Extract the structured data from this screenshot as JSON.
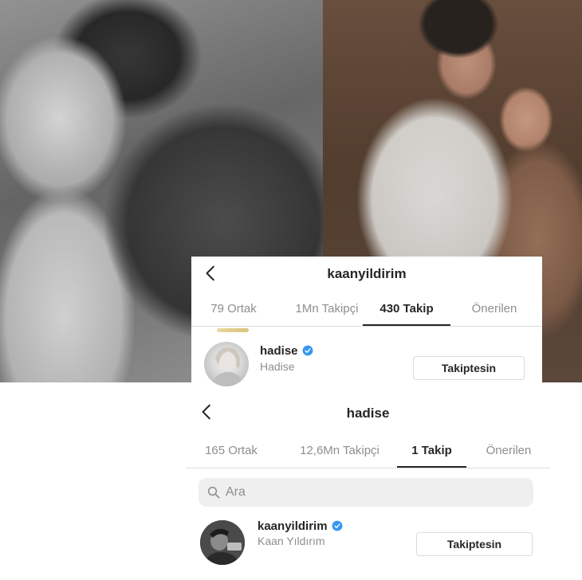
{
  "photos": {
    "left": {
      "name": "black-and-white-couple-photo"
    },
    "right": {
      "name": "color-couple-photo"
    }
  },
  "panel_top": {
    "title": "kaanyildirim",
    "tabs": [
      {
        "label": "79 Ortak",
        "active": false
      },
      {
        "label": "1Mn Takipçi",
        "active": false
      },
      {
        "label": "430 Takip",
        "active": true
      },
      {
        "label": "Önerilen",
        "active": false
      }
    ],
    "row": {
      "username": "hadise",
      "full_name": "Hadise",
      "verified": true,
      "button_label": "Takiptesin"
    }
  },
  "panel_bottom": {
    "title": "hadise",
    "tabs": [
      {
        "label": "165 Ortak",
        "active": false
      },
      {
        "label": "12,6Mn Takipçi",
        "active": false
      },
      {
        "label": "1 Takip",
        "active": true
      },
      {
        "label": "Önerilen",
        "active": false
      }
    ],
    "search": {
      "placeholder": "Ara"
    },
    "row": {
      "username": "kaanyildirim",
      "full_name": "Kaan Yıldırım",
      "verified": true,
      "button_label": "Takiptesin"
    }
  },
  "colors": {
    "verified_badge": "#3897f0",
    "text_primary": "#262626",
    "text_secondary": "#8e8e8e",
    "divider": "#dbdbdb",
    "search_bg": "#efefef"
  },
  "icons": {
    "back": "chevron-left-icon",
    "verified": "verified-badge-icon",
    "search": "search-icon"
  }
}
